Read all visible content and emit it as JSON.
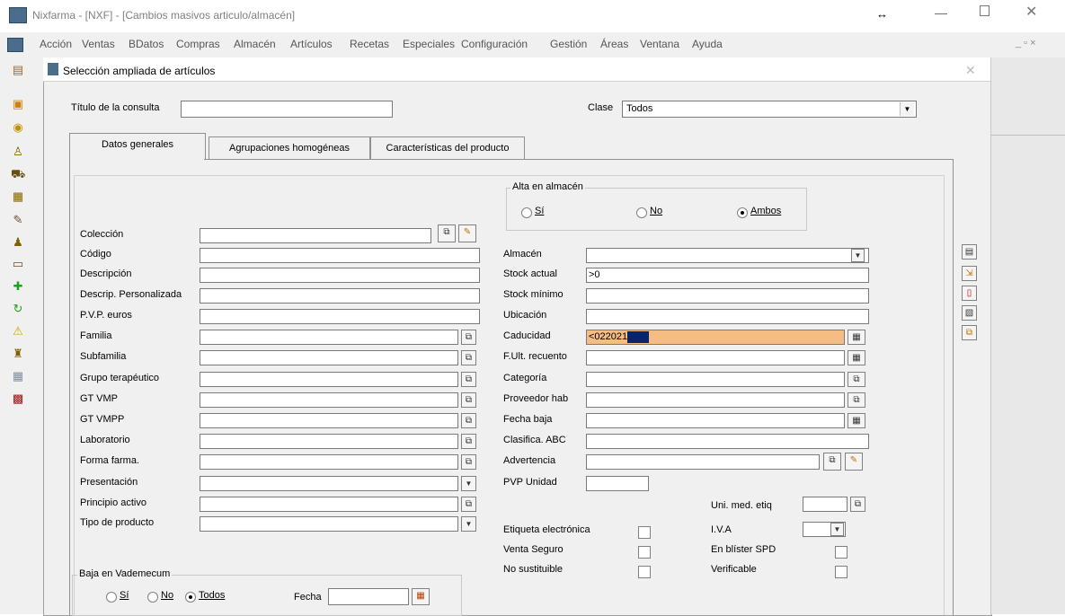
{
  "app": {
    "title": "Nixfarma - [NXF] - [Cambios masivos articulo/almacén]"
  },
  "menu": [
    "Acción",
    "Ventas",
    "BDatos",
    "Compras",
    "Almacén",
    "Artículos",
    "Recetas",
    "Especiales",
    "Configuración",
    "Gestión",
    "Áreas",
    "Ventana",
    "Ayuda"
  ],
  "dialog": {
    "title": "Selección ampliada de artículos"
  },
  "header": {
    "query_title_label": "Título de la consulta",
    "query_title_value": "",
    "class_label": "Clase",
    "class_value": "Todos"
  },
  "tabs": [
    "Datos generales",
    "Agrupaciones homogéneas",
    "Características del producto"
  ],
  "left_fields": [
    {
      "label": "Colección"
    },
    {
      "label": "Código"
    },
    {
      "label": "Descripción"
    },
    {
      "label": "Descrip. Personalizada"
    },
    {
      "label": "P.V.P. euros"
    },
    {
      "label": "Familia"
    },
    {
      "label": "Subfamilia"
    },
    {
      "label": "Grupo terapéutico"
    },
    {
      "label": "GT VMP"
    },
    {
      "label": "GT VMPP"
    },
    {
      "label": "Laboratorio"
    },
    {
      "label": "Forma farma."
    },
    {
      "label": "Presentación"
    },
    {
      "label": "Principio activo"
    },
    {
      "label": "Tipo de producto"
    }
  ],
  "baja": {
    "group_label": "Baja en Vademecum",
    "options": [
      "Sí",
      "No",
      "Todos"
    ],
    "selected": "Todos",
    "fecha_label": "Fecha"
  },
  "alta": {
    "group_label": "Alta en almacén",
    "options": [
      "Sí",
      "No",
      "Ambos"
    ],
    "selected": "Ambos"
  },
  "right_fields": [
    {
      "label": "Almacén",
      "value": ""
    },
    {
      "label": "Stock actual",
      "value": ">0"
    },
    {
      "label": "Stock mínimo",
      "value": ""
    },
    {
      "label": "Ubicación",
      "value": ""
    },
    {
      "label": "Caducidad",
      "value": "<022021"
    },
    {
      "label": "F.Ult. recuento",
      "value": ""
    },
    {
      "label": "Categoría",
      "value": ""
    },
    {
      "label": "Proveedor hab",
      "value": ""
    },
    {
      "label": "Fecha baja",
      "value": ""
    },
    {
      "label": "Clasifica. ABC",
      "value": ""
    },
    {
      "label": "Advertencia",
      "value": ""
    },
    {
      "label": "PVP Unidad",
      "value": ""
    }
  ],
  "extra": {
    "uni_med_label": "Uni. med. etiq",
    "iva_label": "I.V.A"
  },
  "checks": {
    "left": [
      "Etiqueta electrónica",
      "Venta Seguro",
      "No sustituible"
    ],
    "right": [
      "En blíster SPD",
      "Verificable"
    ]
  },
  "colors": {
    "highlight": "#f5bd83",
    "selection": "#0a246a"
  }
}
